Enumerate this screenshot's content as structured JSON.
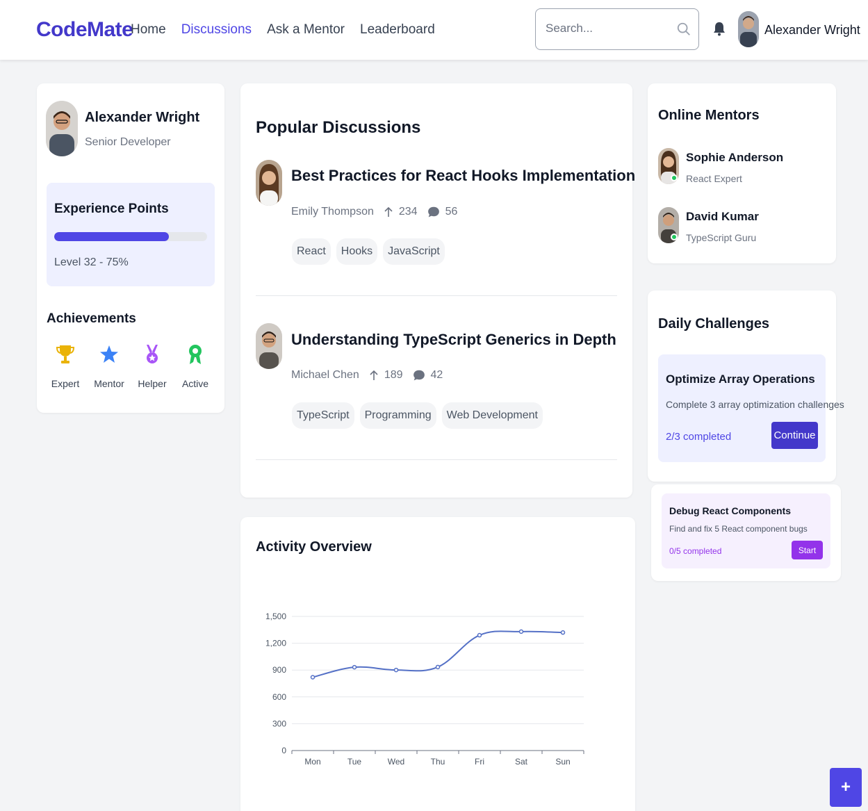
{
  "header": {
    "logo": "CodeMate",
    "nav": [
      {
        "label": "Home",
        "active": false
      },
      {
        "label": "Discussions",
        "active": true
      },
      {
        "label": "Ask a Mentor",
        "active": false
      },
      {
        "label": "Leaderboard",
        "active": false
      }
    ],
    "search_placeholder": "Search...",
    "user_name": "Alexander Wright"
  },
  "profile": {
    "name": "Alexander Wright",
    "role": "Senior Developer",
    "xp_title": "Experience Points",
    "xp_progress": 0.75,
    "xp_level": "Level 32 - 75%",
    "achievements_title": "Achievements",
    "achievements": [
      {
        "label": "Expert",
        "icon": "trophy-icon",
        "color": "#eab308"
      },
      {
        "label": "Mentor",
        "icon": "star-icon",
        "color": "#3b82f6"
      },
      {
        "label": "Helper",
        "icon": "medal-icon",
        "color": "#a855f7"
      },
      {
        "label": "Active",
        "icon": "award-icon",
        "color": "#22c55e"
      }
    ]
  },
  "discussions": {
    "title": "Popular Discussions",
    "items": [
      {
        "title": "Best Practices for React Hooks Implementation",
        "author": "Emily Thompson",
        "upvotes": "234",
        "comments": "56",
        "tags": [
          "React",
          "Hooks",
          "JavaScript"
        ]
      },
      {
        "title": "Understanding TypeScript Generics in Depth",
        "author": "Michael Chen",
        "upvotes": "189",
        "comments": "42",
        "tags": [
          "TypeScript",
          "Programming",
          "Web Development"
        ]
      }
    ]
  },
  "activity": {
    "title": "Activity Overview"
  },
  "chart_data": {
    "type": "line",
    "categories": [
      "Mon",
      "Tue",
      "Wed",
      "Thu",
      "Fri",
      "Sat",
      "Sun"
    ],
    "values": [
      820,
      932,
      901,
      934,
      1290,
      1330,
      1320
    ],
    "ylim": [
      0,
      1500
    ],
    "yticks": [
      "0",
      "300",
      "600",
      "900",
      "1,200",
      "1,500"
    ],
    "grid": true,
    "line_color": "#5470c6"
  },
  "mentors": {
    "title": "Online Mentors",
    "items": [
      {
        "name": "Sophie Anderson",
        "role": "React Expert"
      },
      {
        "name": "David Kumar",
        "role": "TypeScript Guru"
      }
    ]
  },
  "challenges": {
    "title": "Daily Challenges",
    "items": [
      {
        "title": "Optimize Array Operations",
        "desc": "Complete 3 array optimization challenges",
        "progress": "2/3 completed",
        "button": "Continue"
      },
      {
        "title": "Debug React Components",
        "desc": "Find and fix 5 React component bugs",
        "progress": "0/5 completed",
        "button": "Start"
      }
    ]
  },
  "fab_label": "+",
  "colors": {
    "brand": "#4338ca",
    "accent": "#4f46e5",
    "purple": "#9333ea",
    "online": "#22c55e"
  }
}
